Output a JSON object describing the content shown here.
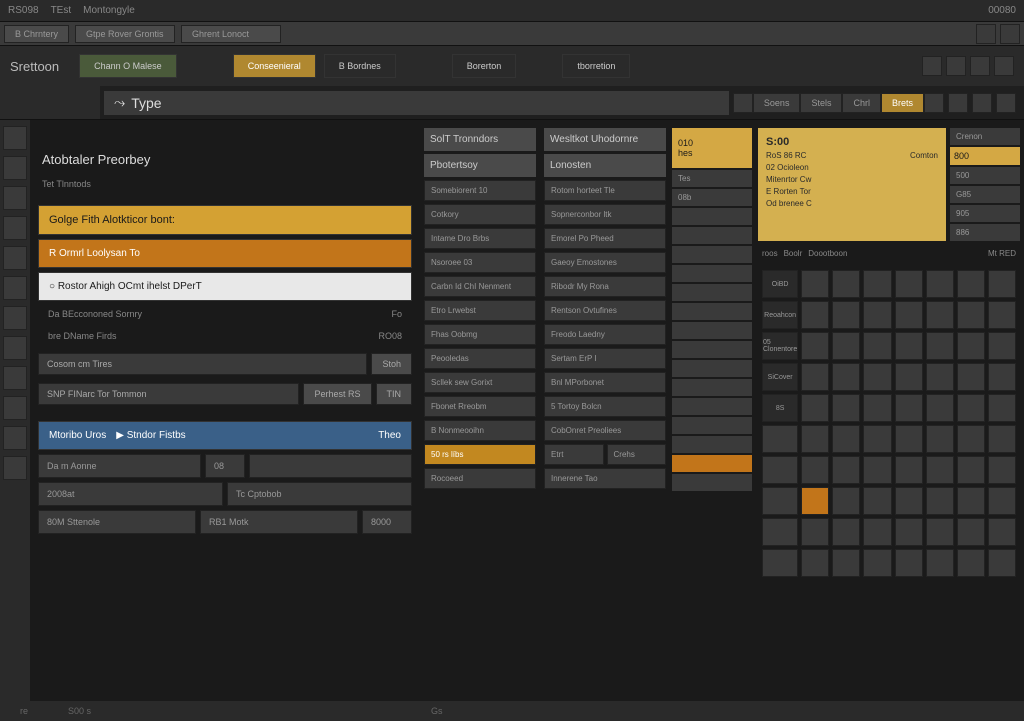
{
  "topbar": {
    "code": "RS098",
    "t1": "TEst",
    "t2": "Montongyle",
    "right": "00080"
  },
  "tabs": [
    "B Chrntery",
    "Gtpe Rover Grontis",
    "Ghrent Lonoct"
  ],
  "toolbar": {
    "label": "Srettoon",
    "btn_green": "Chann O Malese",
    "btn_gold": "Conseenieral",
    "btn_mid": "B Bordnes",
    "btn_dark": "Borerton",
    "btn_right": "tborretion"
  },
  "search": {
    "value": "Type",
    "btn1": "Soens",
    "btn2": "Stels",
    "btn3": "Chrl",
    "btn4": "Brets"
  },
  "col_a": {
    "header": "Atobtaler Preorbey",
    "sub": "Tet Tlnntods",
    "gold": "Golge Fith Alotkticor bont:",
    "orange": "R Ormrl Loolysan To",
    "white": "Rostor Ahigh OCmt ihelst DPerT",
    "kv1_k": "Da BEccononed Sornry",
    "kv1_v": "Fo",
    "kv2_k": "bre DName Firds",
    "kv2_v": "RO08",
    "input": "Cosom cm Tires",
    "input_btn": "Stoh",
    "strip": "SNP FINarc Tor Tommon",
    "strip2": "Perhest RS",
    "strip3": "TIN",
    "blue1": "Mtoribo Uros",
    "blue2": "Stndor Fistbs",
    "blue3": "Theo",
    "r1a": "Da m Aonne",
    "r1b": "08",
    "r2a": "2008at",
    "r2b": "Tc Cptobob",
    "r3a": "80M Sttenole",
    "r3b": "RB1 Motk",
    "r3c": "8000"
  },
  "col_b": {
    "header": "SolT Tronndors",
    "sub": "Pbotertsoy",
    "items": [
      "Somebiorent 10",
      "Cotkory",
      "Intame Dro Brbs",
      "Nsoroee 03",
      "Carbn Id ChI Nenment",
      "Etro Lrwebst",
      "Fhas Oobmg",
      "Peooledas",
      "Scllek sew Gorixt",
      "Fbonet Rreobm",
      "B Nonmeooihn"
    ],
    "items_bottom": [
      "50 rs líbs",
      "Rocoeed"
    ]
  },
  "col_c": {
    "header": "Wesltkot Uhodornre",
    "sub": "Lonosten",
    "items": [
      "Rotom horteet Tle",
      "Sopnerconbor ltk",
      "Emorel Po Pheed",
      "Gaeoy Emostones",
      "Ribodr My Rona",
      "Rentson Ovtufines",
      "Freodo Laedny",
      "Sertam ErP I",
      "Bnl MPorbonet",
      "5 Tortoy Bolcn",
      "CobOnret Preoliees"
    ],
    "extra": [
      "Etrt",
      "Crehs"
    ],
    "bottom": "Innerene Tao"
  },
  "col_d": {
    "gold_top": "010",
    "gold_sub": "hes",
    "rows": [
      "Tes",
      "08b",
      "",
      "",
      "",
      "",
      ""
    ]
  },
  "gold_panel": {
    "title": "S:00",
    "rows": [
      {
        "a": "RoS 86 RC",
        "b": "Comton",
        "c": "500"
      },
      {
        "a": "02 Ocioleon",
        "b": "",
        "c": "G85"
      },
      {
        "a": "Mitenrtor Cw",
        "b": "",
        "c": "905"
      },
      {
        "a": "E Rorten Tor",
        "b": "",
        "c": "886"
      },
      {
        "a": "Od brenee C",
        "b": "",
        "c": ""
      }
    ]
  },
  "right_header": "Crenon",
  "right_header2": "800",
  "meta": [
    "roos",
    "Boolr",
    "Doootboon",
    "Mt RED"
  ],
  "keypad_labels": [
    "OiBD",
    "",
    "Reoahcon",
    "05 Clonentore",
    "SiCover",
    "8S"
  ],
  "footer": {
    "a": "re",
    "b": "S00 s",
    "c": "Gs"
  }
}
